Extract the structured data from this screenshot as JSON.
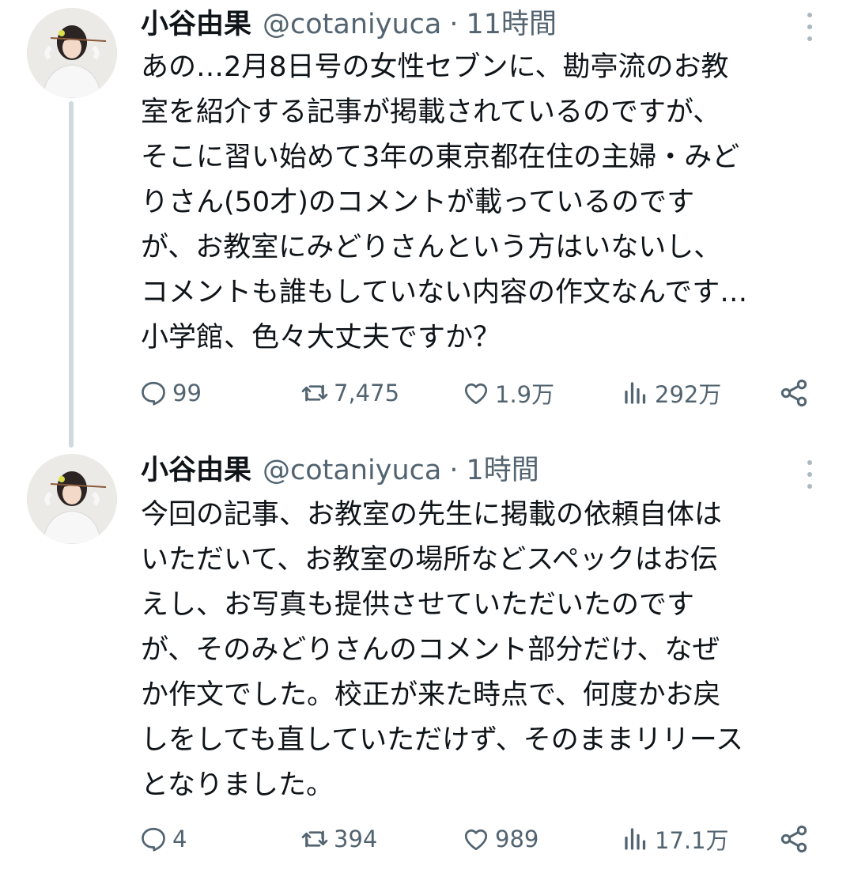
{
  "tweets": [
    {
      "author_name": "小谷由果",
      "handle": "@cotaniyuca",
      "separator": "·",
      "time": "11時間",
      "text_lines": [
        "あの…2月8日号の女性セブンに、勘亭流のお教",
        "室を紹介する記事が掲載されているのですが、",
        "そこに習い始めて3年の東京都在住の主婦・みど",
        "りさん(50才)のコメントが載っているのです",
        "が、お教室にみどりさんという方はいないし、",
        "コメントも誰もしていない内容の作文なんです…",
        "小学館、色々大丈夫ですか？"
      ],
      "replies": "99",
      "retweets": "7,475",
      "likes": "1.9万",
      "views": "292万"
    },
    {
      "author_name": "小谷由果",
      "handle": "@cotaniyuca",
      "separator": "·",
      "time": "1時間",
      "text_lines": [
        "今回の記事、お教室の先生に掲載の依頼自体は",
        "いただいて、お教室の場所などスペックはお伝",
        "えし、お写真も提供させていただいたのです",
        "が、そのみどりさんのコメント部分だけ、なぜ",
        "か作文でした。校正が来た時点で、何度かお戻",
        "しをしても直していただけず、そのままリリース",
        "となりました。"
      ],
      "replies": "4",
      "retweets": "394",
      "likes": "989",
      "views": "17.1万"
    }
  ],
  "icons": {
    "reply": "reply-icon",
    "retweet": "retweet-icon",
    "like": "heart-icon",
    "views": "views-icon",
    "share": "share-icon",
    "more": "more-vertical-icon"
  },
  "colors": {
    "text": "#0f1419",
    "secondary": "#536471",
    "thread_line": "#cfd9de",
    "background": "#ffffff"
  }
}
